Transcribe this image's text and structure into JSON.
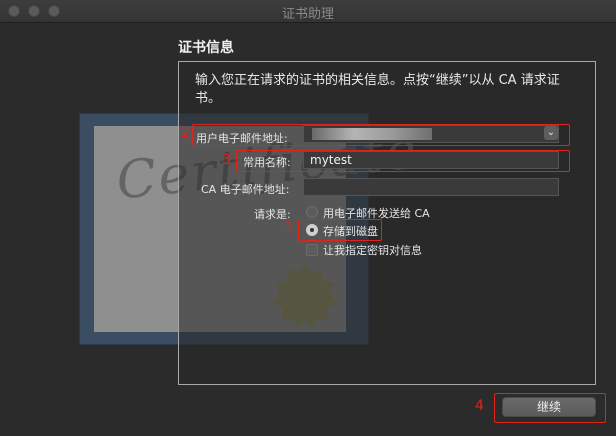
{
  "window": {
    "title": "证书助理"
  },
  "heading": "证书信息",
  "intro": "输入您正在请求的证书的相关信息。点按“继续”以从 CA 请求证书。",
  "form": {
    "email_label": "用户电子邮件地址:",
    "common_name_label": "常用名称:",
    "common_name_value": "mytest",
    "ca_email_label": "CA 电子邮件地址:",
    "ca_email_value": "",
    "request_label": "请求是:",
    "options": [
      {
        "label": "用电子邮件发送给 CA",
        "checked": false
      },
      {
        "label": "存储到磁盘",
        "checked": true
      }
    ],
    "specify_key_label": "让我指定密钥对信息",
    "specify_key_checked": false
  },
  "buttons": {
    "continue_label": "继续"
  },
  "annotations": [
    "1",
    "2",
    "3",
    "4"
  ],
  "colors": {
    "annotation": "#e0241c",
    "background": "#2b2b2b"
  },
  "icons": {
    "dropdown": "chevron-down-icon"
  }
}
